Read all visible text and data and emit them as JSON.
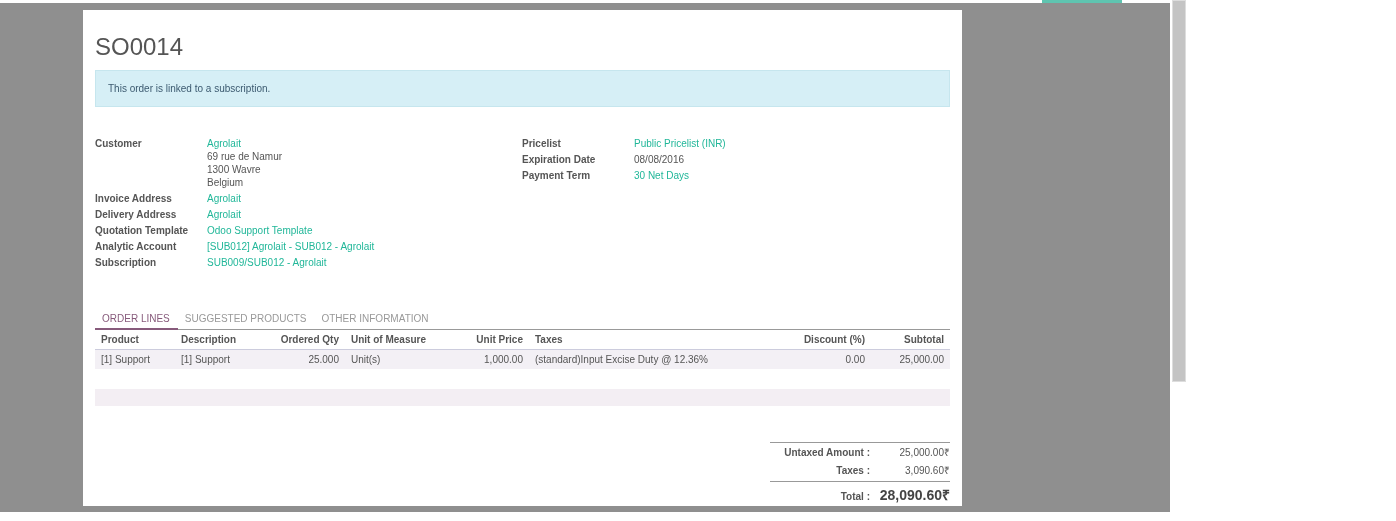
{
  "title": "SO0014",
  "alert": "This order is linked to a subscription.",
  "left_fields": [
    {
      "label": "Customer",
      "lines": [
        {
          "text": "Agrolait",
          "kind": "link"
        },
        {
          "text": "69 rue de Namur",
          "kind": "text"
        },
        {
          "text": "1300 Wavre",
          "kind": "text"
        },
        {
          "text": "Belgium",
          "kind": "text"
        }
      ]
    },
    {
      "label": "Invoice Address",
      "lines": [
        {
          "text": "Agrolait",
          "kind": "link"
        }
      ]
    },
    {
      "label": "Delivery Address",
      "lines": [
        {
          "text": "Agrolait",
          "kind": "link"
        }
      ]
    },
    {
      "label": "Quotation Template",
      "lines": [
        {
          "text": "Odoo Support Template",
          "kind": "link"
        }
      ]
    },
    {
      "label": "Analytic Account",
      "lines": [
        {
          "text": "[SUB012] Agrolait - SUB012 - Agrolait",
          "kind": "link"
        }
      ]
    },
    {
      "label": "Subscription",
      "lines": [
        {
          "text": "SUB009/SUB012 - Agrolait",
          "kind": "link"
        }
      ]
    }
  ],
  "right_fields": [
    {
      "label": "Pricelist",
      "lines": [
        {
          "text": "Public Pricelist (INR)",
          "kind": "link"
        }
      ]
    },
    {
      "label": "Expiration Date",
      "lines": [
        {
          "text": "08/08/2016",
          "kind": "text"
        }
      ]
    },
    {
      "label": "Payment Term",
      "lines": [
        {
          "text": "30 Net Days",
          "kind": "link"
        }
      ]
    }
  ],
  "tabs": [
    {
      "label": "ORDER LINES",
      "selected": true
    },
    {
      "label": "SUGGESTED PRODUCTS",
      "selected": false
    },
    {
      "label": "OTHER INFORMATION",
      "selected": false
    }
  ],
  "table": {
    "columns": [
      {
        "label": "Product",
        "kind": "text"
      },
      {
        "label": "Description",
        "kind": "text"
      },
      {
        "label": "Ordered Qty",
        "kind": "number"
      },
      {
        "label": "Unit of Measure",
        "kind": "text"
      },
      {
        "label": "Unit Price",
        "kind": "number"
      },
      {
        "label": "Taxes",
        "kind": "text"
      },
      {
        "label": "Discount (%)",
        "kind": "number"
      },
      {
        "label": "Subtotal",
        "kind": "number"
      }
    ],
    "rows": [
      [
        "[1] Support",
        "[1] Support",
        "25.000",
        "Unit(s)",
        "1,000.00",
        "(standard)Input Excise Duty @ 12.36%",
        "0.00",
        "25,000.00"
      ]
    ]
  },
  "totals": [
    {
      "label": "Untaxed Amount :",
      "value": "25,000.00₹",
      "kind": "normal"
    },
    {
      "label": "Taxes :",
      "value": "3,090.60₹",
      "kind": "normal"
    },
    {
      "label": "Total :",
      "value": "28,090.60₹",
      "kind": "total"
    }
  ]
}
